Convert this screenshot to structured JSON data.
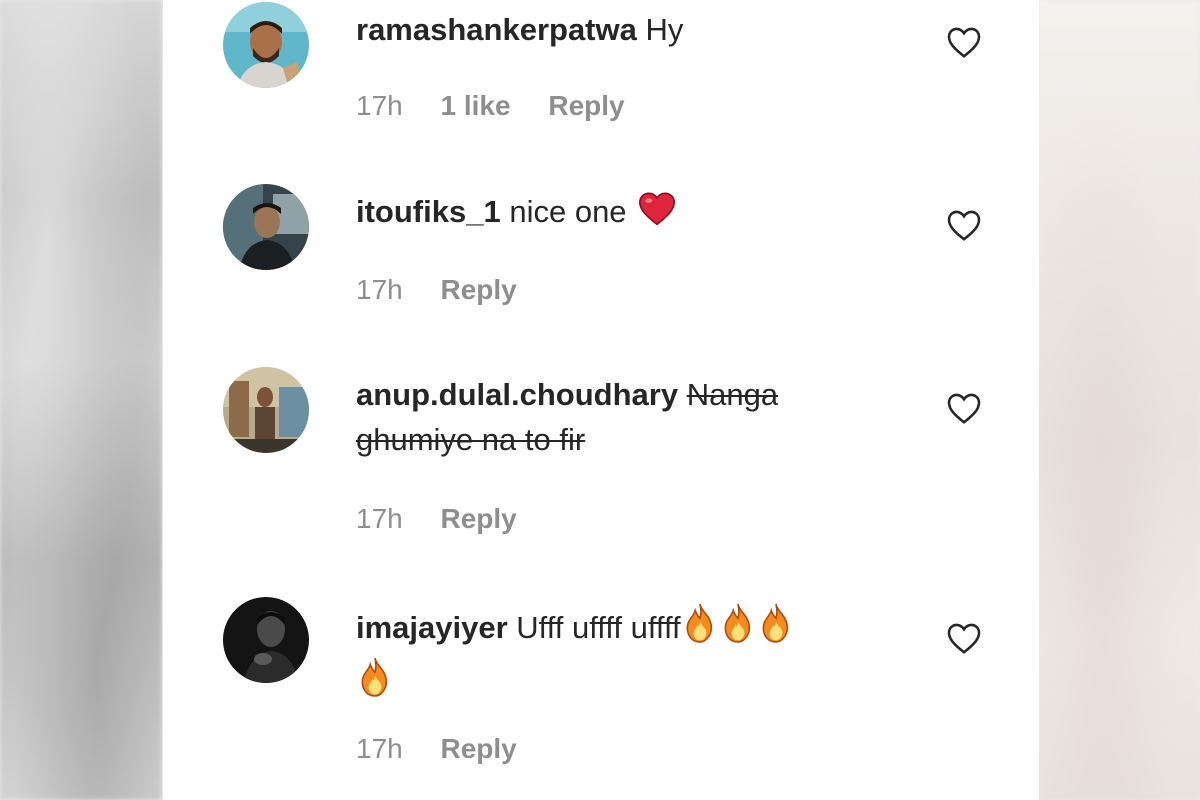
{
  "comments": [
    {
      "username": "ramashankerpatwa",
      "text": "Hy",
      "time": "17h",
      "likes": "1 like",
      "reply": "Reply",
      "like_icon": "heart-outline-icon"
    },
    {
      "username": "itoufiks_1",
      "text": "nice one",
      "emoji": "red-heart",
      "time": "17h",
      "reply": "Reply",
      "like_icon": "heart-outline-icon"
    },
    {
      "username": "anup.dulal.choudhary",
      "text": "Nanga ghumiye na to fir",
      "text_style": "strikethrough",
      "time": "17h",
      "reply": "Reply",
      "like_icon": "heart-outline-icon"
    },
    {
      "username": "imajayiyer",
      "text": "Ufff uffff uffff",
      "emoji": "fire x4",
      "time": "17h",
      "reply": "Reply",
      "like_icon": "heart-outline-icon"
    }
  ],
  "colors": {
    "text_primary": "#262626",
    "text_secondary": "#8e8e8e",
    "heart_red": "#e0243b",
    "fire_orange": "#f58a1f"
  }
}
